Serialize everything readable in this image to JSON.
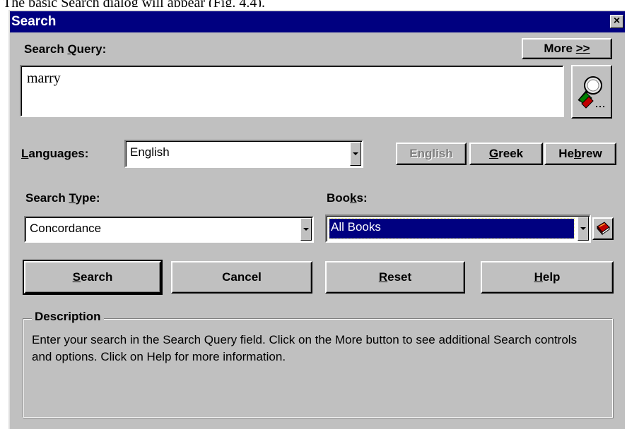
{
  "caption_fragment": "The basic Search dialog will appear (Fig. 4.4).",
  "window": {
    "title": "Search",
    "close_label": "×"
  },
  "query": {
    "label_pre": "Search ",
    "label_key": "Q",
    "label_post": "uery:",
    "value": "marry",
    "more_label_pre": "More ",
    "more_label_key": ">>"
  },
  "languages": {
    "label_key": "L",
    "label_post": "anguages:",
    "selected": "English",
    "buttons": [
      {
        "label": "English",
        "state": "disabled"
      },
      {
        "label_key": "G",
        "label_post": "reek"
      },
      {
        "label_pre": "He",
        "label_key": "b",
        "label_post": "rew"
      }
    ]
  },
  "search_type": {
    "label_pre": "Search ",
    "label_key": "T",
    "label_post": "ype:",
    "selected": "Concordance"
  },
  "books": {
    "label_pre": "Boo",
    "label_key": "k",
    "label_post": "s:",
    "selected": "All Books"
  },
  "actions": {
    "search": {
      "key": "S",
      "rest": "earch"
    },
    "cancel": "Cancel",
    "reset": {
      "key": "R",
      "rest": "eset"
    },
    "help": {
      "key": "H",
      "rest": "elp"
    }
  },
  "description": {
    "legend": "Description",
    "text": "Enter your search in the Search Query field. Click on the More button to see additional Search controls and options. Click on Help for more information."
  },
  "icons": [
    "search-magnifier-icon",
    "book-icon",
    "combo-arrow-icon",
    "close-icon"
  ],
  "colors": {
    "titlebar": "#000080",
    "face": "#c0c0c0",
    "selection": "#000080"
  }
}
